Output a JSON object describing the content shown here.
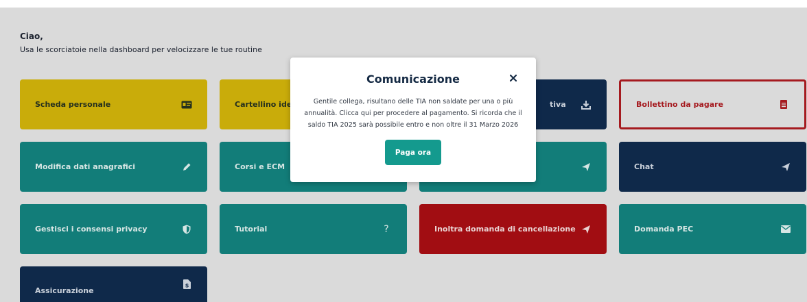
{
  "header": {
    "greeting": "Ciao,",
    "subtitle": "Usa le scorciatoie nella dashboard per velocizzare le tue routine"
  },
  "cards": [
    {
      "label": "Scheda personale",
      "icon": "id-card-icon",
      "style": "yellow"
    },
    {
      "label": "Cartellino identi",
      "icon": "",
      "style": "yellow"
    },
    {
      "label": "tiva",
      "icon": "download-icon",
      "style": "navy"
    },
    {
      "label": "Bollettino da pagare",
      "icon": "document-icon",
      "style": "outline-red"
    },
    {
      "label": "Modifica dati anagrafici",
      "icon": "pencil-icon",
      "style": "teal"
    },
    {
      "label": "Corsi e ECM",
      "icon": "",
      "style": "teal"
    },
    {
      "label": "",
      "icon": "send-icon",
      "style": "teal"
    },
    {
      "label": "Chat",
      "icon": "send-icon",
      "style": "navy"
    },
    {
      "label": "Gestisci i consensi privacy",
      "icon": "shield-icon",
      "style": "teal"
    },
    {
      "label": "Tutorial",
      "icon": "question-icon",
      "style": "teal"
    },
    {
      "label": "Inoltra domanda di cancellazione",
      "icon": "send-icon",
      "style": "red"
    },
    {
      "label": "Domanda PEC",
      "icon": "envelope-icon",
      "style": "teal"
    },
    {
      "label": "Assicurazione",
      "icon": "file-dollar-icon",
      "style": "navy"
    }
  ],
  "modal": {
    "title": "Comunicazione",
    "close_label": "×",
    "body_line1": "Gentile collega, risultano delle TIA non saldate per una o più",
    "body_line2": "annualità. Clicca qui per procedere al pagamento. Si ricorda che il",
    "body_line3": "saldo TIA 2025 sarà possibile entro e non oltre il 31 Marzo 2026",
    "button_label": "Paga ora"
  },
  "colors": {
    "yellow": "#c9ac0a",
    "teal": "#127d79",
    "navy": "#0f294a",
    "red": "#a10d12",
    "modal_button": "#149a8e"
  }
}
